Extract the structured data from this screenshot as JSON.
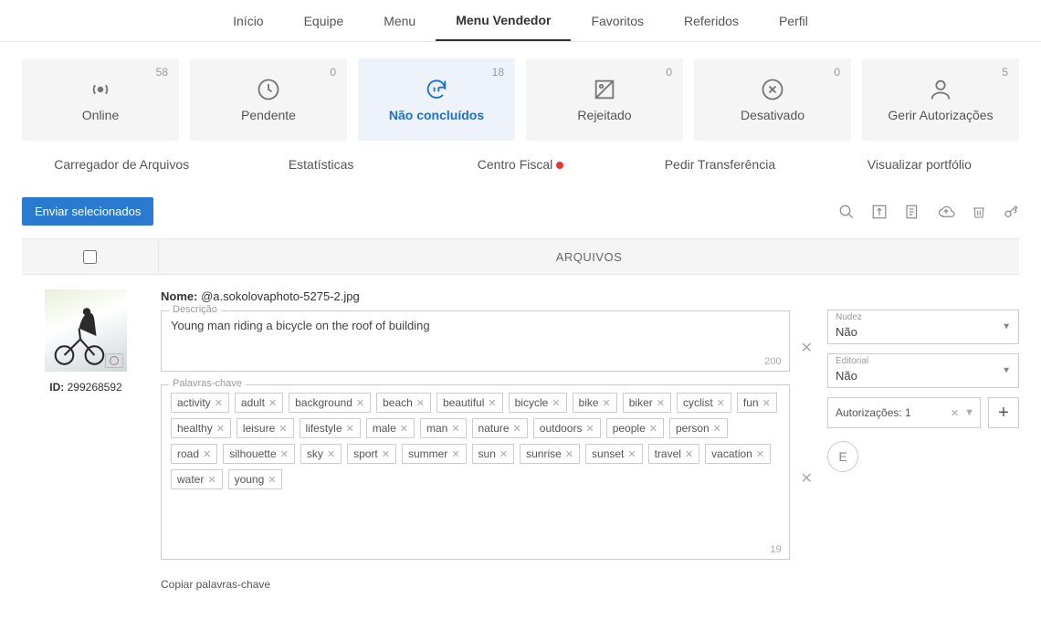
{
  "topnav": [
    {
      "label": "Início",
      "active": false
    },
    {
      "label": "Equipe",
      "active": false
    },
    {
      "label": "Menu",
      "active": false
    },
    {
      "label": "Menu Vendedor",
      "active": true
    },
    {
      "label": "Favoritos",
      "active": false
    },
    {
      "label": "Referidos",
      "active": false
    },
    {
      "label": "Perfil",
      "active": false
    }
  ],
  "cards": [
    {
      "label": "Online",
      "count": "58",
      "icon": "broadcast",
      "active": false
    },
    {
      "label": "Pendente",
      "count": "0",
      "icon": "clock",
      "active": false
    },
    {
      "label": "Não concluídos",
      "count": "18",
      "icon": "refresh-pause",
      "active": true
    },
    {
      "label": "Rejeitado",
      "count": "0",
      "icon": "image-off",
      "active": false
    },
    {
      "label": "Desativado",
      "count": "0",
      "icon": "x-circle",
      "active": false
    },
    {
      "label": "Gerir Autorizações",
      "count": "5",
      "icon": "person",
      "active": false
    }
  ],
  "subnav": [
    {
      "label": "Carregador de Arquivos",
      "dot": false
    },
    {
      "label": "Estatísticas",
      "dot": false
    },
    {
      "label": "Centro Fiscal",
      "dot": true
    },
    {
      "label": "Pedir Transferência",
      "dot": false
    },
    {
      "label": "Visualizar portfólio",
      "dot": false
    }
  ],
  "actions": {
    "send_selected": "Enviar selecionados"
  },
  "tablehead": {
    "files": "ARQUIVOS"
  },
  "row": {
    "id_label": "ID:",
    "id_value": "299268592",
    "name_label": "Nome:",
    "name_value": "@a.sokolovaphoto-5275-2.jpg",
    "desc_label": "Descrição",
    "desc_value": "Young man riding a bicycle on the roof of building",
    "desc_counter": "200",
    "keywords_label": "Palavras-chave",
    "keywords": [
      "activity",
      "adult",
      "background",
      "beach",
      "beautiful",
      "bicycle",
      "bike",
      "biker",
      "cyclist",
      "fun",
      "healthy",
      "leisure",
      "lifestyle",
      "male",
      "man",
      "nature",
      "outdoors",
      "people",
      "person",
      "road",
      "silhouette",
      "sky",
      "sport",
      "summer",
      "sun",
      "sunrise",
      "sunset",
      "travel",
      "vacation",
      "water",
      "young"
    ],
    "keywords_counter": "19",
    "copy_keywords": "Copiar palavras-chave"
  },
  "side": {
    "nudity_label": "Nudez",
    "nudity_value": "Não",
    "editorial_label": "Editorial",
    "editorial_value": "Não",
    "auth_label": "Autorizações",
    "auth_count": "1",
    "e_badge": "E"
  }
}
